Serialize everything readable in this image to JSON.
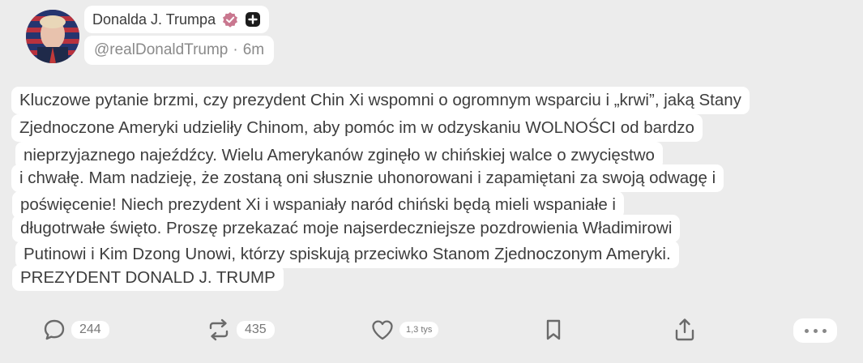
{
  "post": {
    "author_name": "Donalda J. Trumpa",
    "handle": "@realDonaldTrump",
    "separator": "·",
    "time_ago": "6m",
    "lines": [
      "Kluczowe pytanie brzmi, czy prezydent Chin Xi wspomni o ogromnym wsparciu i „krwi”, jaką Stany",
      "Zjednoczone Ameryki udzieliły Chinom, aby pomóc im w odzyskaniu WOLNOŚCI od bardzo",
      "nieprzyjaznego najeźdźcy. Wielu Amerykanów zginęło w chińskiej walce o zwycięstwo",
      "i chwałę. Mam nadzieję, że zostaną oni słusznie uhonorowani i zapamiętani za swoją odwagę i",
      "poświęcenie! Niech prezydent Xi i wspaniały naród chiński będą mieli wspaniałe i",
      "długotrwałe święto. Proszę przekazać moje najserdeczniejsze pozdrowienia Władimirowi",
      "Putinowi i Kim Dzong Unowi, którzy spiskują przeciwko Stanom Zjednoczonym Ameryki.",
      "PREZYDENT DONALD J. TRUMP"
    ]
  },
  "actions": {
    "replies": "244",
    "reposts": "435",
    "likes": "1,3 tys"
  },
  "icons": {
    "verified": "verified-badge-icon",
    "plus": "plus-badge-icon",
    "reply": "comment-icon",
    "repost": "repost-icon",
    "like": "heart-icon",
    "bookmark": "bookmark-icon",
    "share": "share-icon",
    "more": "more-dots-icon"
  },
  "colors": {
    "background": "#ececec",
    "pill": "#ffffff",
    "verified": "#c9778f",
    "text": "#3d3d3d",
    "muted": "#8a8a8a"
  }
}
